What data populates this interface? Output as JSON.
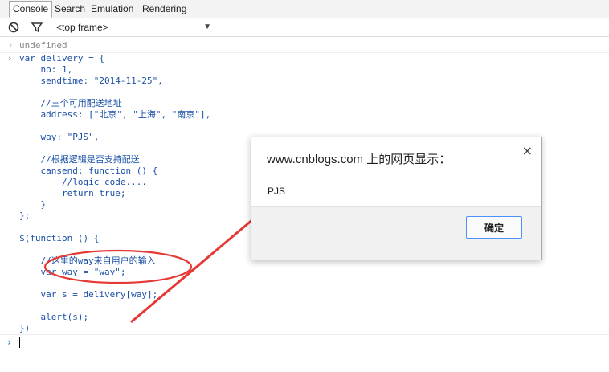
{
  "tabs": [
    {
      "label": "Console",
      "active": true
    },
    {
      "label": "Search",
      "active": false
    },
    {
      "label": "Emulation",
      "active": false
    },
    {
      "label": "Rendering",
      "active": false
    }
  ],
  "toolbar": {
    "clear_icon": "no-entry-icon",
    "filter_icon": "funnel-icon",
    "frame": "<top frame>"
  },
  "console": {
    "result_text": "undefined",
    "code": "var delivery = {\n    no: 1,\n    sendtime: \"2014-11-25\",\n\n    //三个可用配送地址\n    address: [\"北京\", \"上海\", \"南京\"],\n\n    way: \"PJS\",\n\n    //根据逻辑是否支持配送\n    cansend: function () {\n        //logic code....\n        return true;\n    }\n};\n\n$(function () {\n\n    //这里的way来自用户的输入\n    var way = \"way\";\n\n    var s = delivery[way];\n\n    alert(s);\n})"
  },
  "dialog": {
    "title": "www.cnblogs.com 上的网页显示：",
    "message": "PJS",
    "ok_label": "确定",
    "close_symbol": "×"
  },
  "colors": {
    "code": "#1a4fa6",
    "annotation": "#e53935",
    "ok_border": "#4d90fe"
  }
}
